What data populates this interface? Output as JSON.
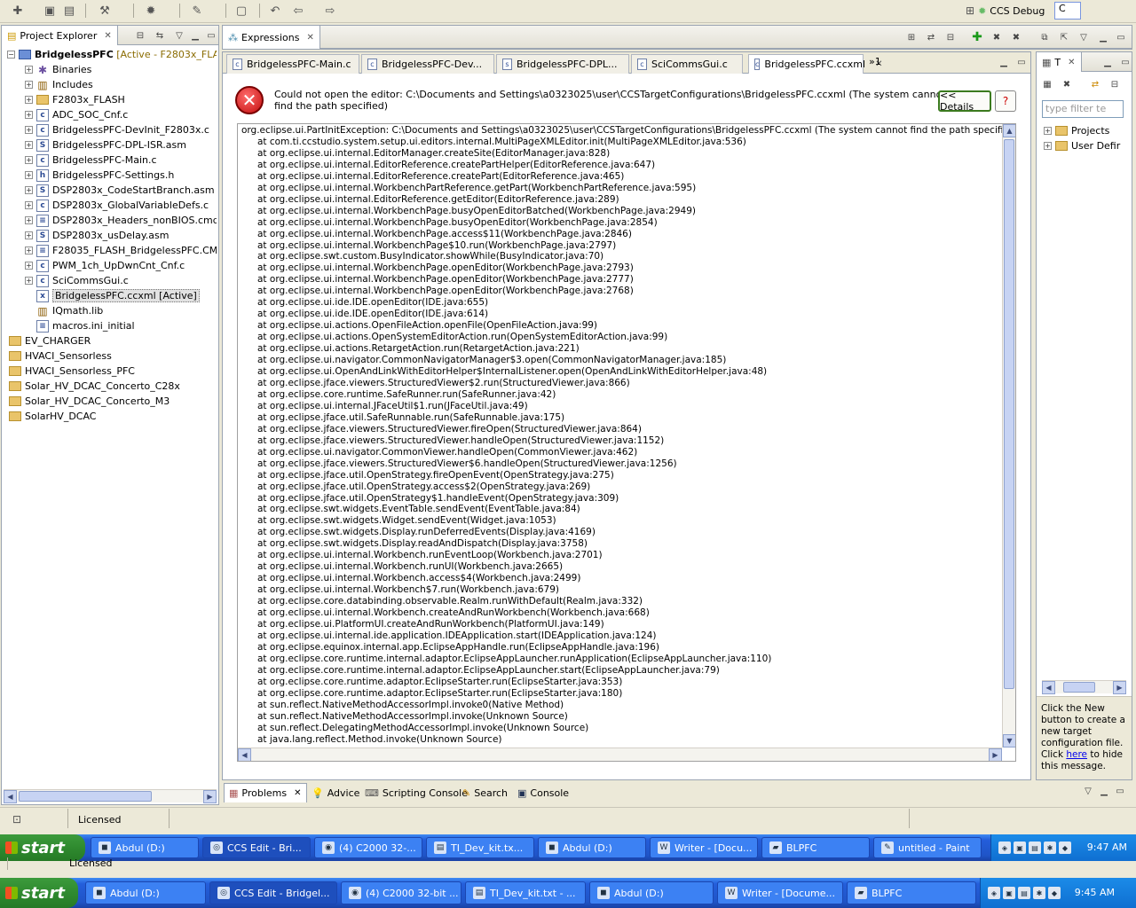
{
  "perspectives": {
    "debug_label": "CCS Debug",
    "edit_label": "C"
  },
  "project_explorer": {
    "tab_label": "Project Explorer",
    "root": {
      "name": "BridgelessPFC",
      "status": "[Active - F2803x_FLA"
    },
    "children": [
      {
        "label": "Binaries",
        "icon": "binaries-icon",
        "expandable": true
      },
      {
        "label": "Includes",
        "icon": "includes-icon",
        "expandable": true
      },
      {
        "label": "F2803x_FLASH",
        "icon": "folder-icon",
        "expandable": true
      },
      {
        "label": "ADC_SOC_Cnf.c",
        "icon": "c-file-icon",
        "expandable": true
      },
      {
        "label": "BridgelessPFC-DevInit_F2803x.c",
        "icon": "c-file-icon",
        "expandable": true
      },
      {
        "label": "BridgelessPFC-DPL-ISR.asm",
        "icon": "asm-file-icon",
        "expandable": true
      },
      {
        "label": "BridgelessPFC-Main.c",
        "icon": "c-file-icon",
        "expandable": true
      },
      {
        "label": "BridgelessPFC-Settings.h",
        "icon": "h-file-icon",
        "expandable": true
      },
      {
        "label": "DSP2803x_CodeStartBranch.asm",
        "icon": "asm-file-icon",
        "expandable": true
      },
      {
        "label": "DSP2803x_GlobalVariableDefs.c",
        "icon": "c-file-icon",
        "expandable": true
      },
      {
        "label": "DSP2803x_Headers_nonBIOS.cmd",
        "icon": "cmd-file-icon",
        "expandable": true
      },
      {
        "label": "DSP2803x_usDelay.asm",
        "icon": "asm-file-icon",
        "expandable": true
      },
      {
        "label": "F28035_FLASH_BridgelessPFC.CMD",
        "icon": "cmd-file-icon",
        "expandable": true
      },
      {
        "label": "PWM_1ch_UpDwnCnt_Cnf.c",
        "icon": "c-file-icon",
        "expandable": true
      },
      {
        "label": "SciCommsGui.c",
        "icon": "c-file-icon",
        "expandable": true
      },
      {
        "label": "BridgelessPFC.ccxml [Active]",
        "icon": "ccxml-file-icon",
        "expandable": false,
        "selected": true
      },
      {
        "label": "IQmath.lib",
        "icon": "lib-file-icon",
        "expandable": false
      },
      {
        "label": "macros.ini_initial",
        "icon": "text-file-icon",
        "expandable": false
      }
    ],
    "projects": [
      "EV_CHARGER",
      "HVACI_Sensorless",
      "HVACI_Sensorless_PFC",
      "Solar_HV_DCAC_Concerto_C28x",
      "Solar_HV_DCAC_Concerto_M3",
      "SolarHV_DCAC"
    ]
  },
  "expressions_tab": {
    "label": "Expressions"
  },
  "editor_tabs": [
    {
      "label": "BridgelessPFC-Main.c",
      "type": "c"
    },
    {
      "label": "BridgelessPFC-Dev...",
      "type": "c"
    },
    {
      "label": "BridgelessPFC-DPL...",
      "type": "s"
    },
    {
      "label": "SciCommsGui.c",
      "type": "c"
    },
    {
      "label": "BridgelessPFC.ccxml",
      "type": "ccxml",
      "active": true
    }
  ],
  "editor_overflow": "1",
  "error": {
    "message": "Could not open the editor: C:\\Documents and Settings\\a0323025\\user\\CCSTargetConfigurations\\BridgelessPFC.ccxml (The system cannot find the path specified)",
    "details_label": "<< Details",
    "trace": [
      "org.eclipse.ui.PartInitException: C:\\Documents and Settings\\a0323025\\user\\CCSTargetConfigurations\\BridgelessPFC.ccxml (The system cannot find the path specified)",
      "\tat com.ti.ccstudio.system.setup.ui.editors.internal.MultiPageXMLEditor.init(MultiPageXMLEditor.java:536)",
      "\tat org.eclipse.ui.internal.EditorManager.createSite(EditorManager.java:828)",
      "\tat org.eclipse.ui.internal.EditorReference.createPartHelper(EditorReference.java:647)",
      "\tat org.eclipse.ui.internal.EditorReference.createPart(EditorReference.java:465)",
      "\tat org.eclipse.ui.internal.WorkbenchPartReference.getPart(WorkbenchPartReference.java:595)",
      "\tat org.eclipse.ui.internal.EditorReference.getEditor(EditorReference.java:289)",
      "\tat org.eclipse.ui.internal.WorkbenchPage.busyOpenEditorBatched(WorkbenchPage.java:2949)",
      "\tat org.eclipse.ui.internal.WorkbenchPage.busyOpenEditor(WorkbenchPage.java:2854)",
      "\tat org.eclipse.ui.internal.WorkbenchPage.access$11(WorkbenchPage.java:2846)",
      "\tat org.eclipse.ui.internal.WorkbenchPage$10.run(WorkbenchPage.java:2797)",
      "\tat org.eclipse.swt.custom.BusyIndicator.showWhile(BusyIndicator.java:70)",
      "\tat org.eclipse.ui.internal.WorkbenchPage.openEditor(WorkbenchPage.java:2793)",
      "\tat org.eclipse.ui.internal.WorkbenchPage.openEditor(WorkbenchPage.java:2777)",
      "\tat org.eclipse.ui.internal.WorkbenchPage.openEditor(WorkbenchPage.java:2768)",
      "\tat org.eclipse.ui.ide.IDE.openEditor(IDE.java:655)",
      "\tat org.eclipse.ui.ide.IDE.openEditor(IDE.java:614)",
      "\tat org.eclipse.ui.actions.OpenFileAction.openFile(OpenFileAction.java:99)",
      "\tat org.eclipse.ui.actions.OpenSystemEditorAction.run(OpenSystemEditorAction.java:99)",
      "\tat org.eclipse.ui.actions.RetargetAction.run(RetargetAction.java:221)",
      "\tat org.eclipse.ui.navigator.CommonNavigatorManager$3.open(CommonNavigatorManager.java:185)",
      "\tat org.eclipse.ui.OpenAndLinkWithEditorHelper$InternalListener.open(OpenAndLinkWithEditorHelper.java:48)",
      "\tat org.eclipse.jface.viewers.StructuredViewer$2.run(StructuredViewer.java:866)",
      "\tat org.eclipse.core.runtime.SafeRunner.run(SafeRunner.java:42)",
      "\tat org.eclipse.ui.internal.JFaceUtil$1.run(JFaceUtil.java:49)",
      "\tat org.eclipse.jface.util.SafeRunnable.run(SafeRunnable.java:175)",
      "\tat org.eclipse.jface.viewers.StructuredViewer.fireOpen(StructuredViewer.java:864)",
      "\tat org.eclipse.jface.viewers.StructuredViewer.handleOpen(StructuredViewer.java:1152)",
      "\tat org.eclipse.ui.navigator.CommonViewer.handleOpen(CommonViewer.java:462)",
      "\tat org.eclipse.jface.viewers.StructuredViewer$6.handleOpen(StructuredViewer.java:1256)",
      "\tat org.eclipse.jface.util.OpenStrategy.fireOpenEvent(OpenStrategy.java:275)",
      "\tat org.eclipse.jface.util.OpenStrategy.access$2(OpenStrategy.java:269)",
      "\tat org.eclipse.jface.util.OpenStrategy$1.handleEvent(OpenStrategy.java:309)",
      "\tat org.eclipse.swt.widgets.EventTable.sendEvent(EventTable.java:84)",
      "\tat org.eclipse.swt.widgets.Widget.sendEvent(Widget.java:1053)",
      "\tat org.eclipse.swt.widgets.Display.runDeferredEvents(Display.java:4169)",
      "\tat org.eclipse.swt.widgets.Display.readAndDispatch(Display.java:3758)",
      "\tat org.eclipse.ui.internal.Workbench.runEventLoop(Workbench.java:2701)",
      "\tat org.eclipse.ui.internal.Workbench.runUI(Workbench.java:2665)",
      "\tat org.eclipse.ui.internal.Workbench.access$4(Workbench.java:2499)",
      "\tat org.eclipse.ui.internal.Workbench$7.run(Workbench.java:679)",
      "\tat org.eclipse.core.databinding.observable.Realm.runWithDefault(Realm.java:332)",
      "\tat org.eclipse.ui.internal.Workbench.createAndRunWorkbench(Workbench.java:668)",
      "\tat org.eclipse.ui.PlatformUI.createAndRunWorkbench(PlatformUI.java:149)",
      "\tat org.eclipse.ui.internal.ide.application.IDEApplication.start(IDEApplication.java:124)",
      "\tat org.eclipse.equinox.internal.app.EclipseAppHandle.run(EclipseAppHandle.java:196)",
      "\tat org.eclipse.core.runtime.internal.adaptor.EclipseAppLauncher.runApplication(EclipseAppLauncher.java:110)",
      "\tat org.eclipse.core.runtime.internal.adaptor.EclipseAppLauncher.start(EclipseAppLauncher.java:79)",
      "\tat org.eclipse.core.runtime.adaptor.EclipseStarter.run(EclipseStarter.java:353)",
      "\tat org.eclipse.core.runtime.adaptor.EclipseStarter.run(EclipseStarter.java:180)",
      "\tat sun.reflect.NativeMethodAccessorImpl.invoke0(Native Method)",
      "\tat sun.reflect.NativeMethodAccessorImpl.invoke(Unknown Source)",
      "\tat sun.reflect.DelegatingMethodAccessorImpl.invoke(Unknown Source)",
      "\tat java.lang.reflect.Method.invoke(Unknown Source)"
    ]
  },
  "target_view": {
    "tab_label": "T",
    "filter_placeholder": "type filter te",
    "nodes": [
      "Projects",
      "User Defir"
    ],
    "help_prefix": "Click the New button to create a new target configuration file. Click ",
    "help_link": "here",
    "help_suffix": " to hide this message."
  },
  "bottom_tabs": [
    "Problems",
    "Advice",
    "Scripting Console",
    "Search",
    "Console"
  ],
  "status": {
    "license": "Licensed",
    "license_ghost": "Licensed"
  },
  "taskbar_main": {
    "start": "start",
    "tasks": [
      "Abdul (D:)",
      "CCS Edit - Bri...",
      "(4) C2000 32-...",
      "TI_Dev_kit.tx...",
      "Abdul (D:)",
      "Writer - [Docu...",
      "BLPFC",
      "untitled - Paint"
    ],
    "active_index": 1,
    "clock": "9:47 AM"
  },
  "taskbar_ghost": {
    "start": "start",
    "tasks": [
      "Abdul (D:)",
      "CCS Edit - Bridgel...",
      "(4) C2000 32-bit ...",
      "TI_Dev_kit.txt - ...",
      "Abdul (D:)",
      "Writer - [Docume...",
      "BLPFC"
    ],
    "active_index": 1,
    "clock": "9:45 AM"
  },
  "colors": {
    "error_red": "#c30d0d",
    "taskbar_blue": "#245edb",
    "start_green": "#2f8a2f",
    "details_border": "#3b7a1e"
  }
}
